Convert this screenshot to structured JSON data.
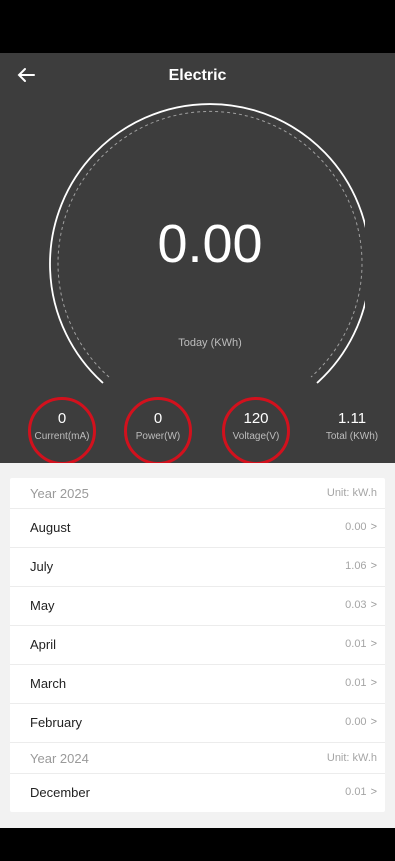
{
  "header": {
    "title": "Electric"
  },
  "gauge": {
    "value": "0.00",
    "label": "Today (KWh)"
  },
  "metrics": [
    {
      "value": "0",
      "label": "Current(mA)"
    },
    {
      "value": "0",
      "label": "Power(W)"
    },
    {
      "value": "120",
      "label": "Voltage(V)"
    },
    {
      "value": "1.11",
      "label": "Total (KWh)"
    }
  ],
  "history": {
    "y2025": {
      "year": "Year 2025",
      "unit": "Unit: kW.h",
      "months": [
        {
          "name": "August",
          "value": "0.00"
        },
        {
          "name": "July",
          "value": "1.06"
        },
        {
          "name": "May",
          "value": "0.03"
        },
        {
          "name": "April",
          "value": "0.01"
        },
        {
          "name": "March",
          "value": "0.01"
        },
        {
          "name": "February",
          "value": "0.00"
        }
      ]
    },
    "y2024": {
      "year": "Year 2024",
      "unit": "Unit: kW.h",
      "months": [
        {
          "name": "December",
          "value": "0.01"
        }
      ]
    }
  },
  "chevron": ">",
  "colors": {
    "dark": "#3d3d3d",
    "ring": "#d2111d"
  }
}
